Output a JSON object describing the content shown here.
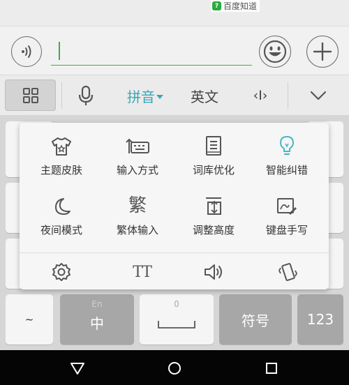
{
  "watermark": {
    "logo_char": "?",
    "text": "百度知道"
  },
  "input_row": {
    "icons": [
      "voice-icon",
      "emoji-icon",
      "plus-icon"
    ],
    "value": ""
  },
  "toolbar": {
    "active_color": "#38a8b4",
    "pinyin_label": "拼音",
    "english_label": "英文",
    "cursor_label": "‹I›",
    "icons": [
      "grid-menu-icon",
      "microphone-icon",
      "cursor-move-icon",
      "chevron-down-icon"
    ]
  },
  "menu": {
    "items": [
      {
        "label": "主题皮肤",
        "icon": "tshirt-icon"
      },
      {
        "label": "输入方式",
        "icon": "keyboard-layout-icon"
      },
      {
        "label": "词库优化",
        "icon": "dictionary-icon"
      },
      {
        "label": "智能纠错",
        "icon": "lightbulb-icon"
      },
      {
        "label": "夜间模式",
        "icon": "moon-icon"
      },
      {
        "label": "繁体输入",
        "icon": "traditional-char-icon",
        "glyph": "繁"
      },
      {
        "label": "调整高度",
        "icon": "height-adjust-icon"
      },
      {
        "label": "键盘手写",
        "icon": "handwriting-icon"
      }
    ],
    "bottom_icons": [
      "settings-icon",
      "font-size-icon",
      "volume-icon",
      "vibration-icon"
    ],
    "font_size_glyph": "TT",
    "accent_color": "#4ab6c4"
  },
  "keys": {
    "tilde": "~",
    "zhong": "中",
    "zhong_hint": "En",
    "space_hint": "0",
    "symbol": "符号",
    "num": "123"
  },
  "navbar": {
    "icons": [
      "back-icon",
      "home-icon",
      "recents-icon"
    ]
  }
}
